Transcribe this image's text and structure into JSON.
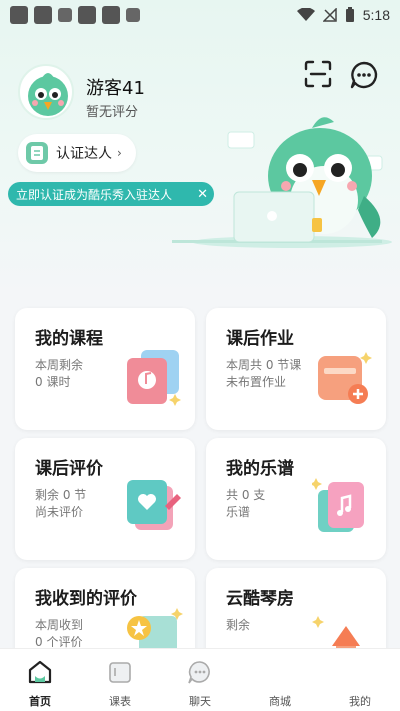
{
  "status_bar": {
    "time": "5:18"
  },
  "profile": {
    "name": "游客41",
    "rating": "暂无评分"
  },
  "certify": {
    "label": "认证达人",
    "arrow": "›"
  },
  "promo": {
    "text": "立即认证成为酷乐秀入驻达人",
    "close": "✕"
  },
  "cards": [
    {
      "title": "我的课程",
      "lines": [
        "本周剩余",
        "0 课时"
      ],
      "icon": "music-book-illustration"
    },
    {
      "title": "课后作业",
      "lines": [
        "本周共 0 节课",
        "未布置作业"
      ],
      "icon": "homework-illustration"
    },
    {
      "title": "课后评价",
      "lines": [
        "剩余 0 节",
        "尚未评价"
      ],
      "icon": "heart-note-illustration"
    },
    {
      "title": "我的乐谱",
      "lines": [
        "共 0 支",
        "乐谱"
      ],
      "icon": "sheet-music-illustration"
    },
    {
      "title": "我收到的评价",
      "lines": [
        "本周收到",
        "0 个评价"
      ],
      "icon": "medal-certificate-illustration"
    },
    {
      "title": "云酷琴房",
      "lines": [
        "剩余"
      ],
      "icon": "piano-room-illustration"
    }
  ],
  "nav": [
    {
      "label": "首页",
      "icon": "home-icon",
      "active": true
    },
    {
      "label": "课表",
      "icon": "schedule-icon",
      "active": false
    },
    {
      "label": "聊天",
      "icon": "chat-icon",
      "active": false
    },
    {
      "label": "商城",
      "icon": "shop-icon",
      "active": false
    },
    {
      "label": "我的",
      "icon": "profile-icon",
      "active": false
    }
  ],
  "colors": {
    "accent": "#2fb8ad",
    "mint": "#6ec9a8",
    "background": "#f4f6f8"
  }
}
